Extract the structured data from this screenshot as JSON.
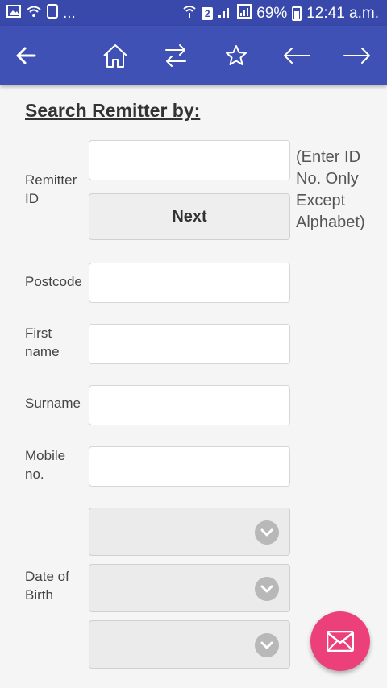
{
  "status_bar": {
    "overflow_dots": "...",
    "sim_number": "2",
    "battery": "69%",
    "time": "12:41 a.m."
  },
  "toolbar": {
    "icons": [
      "back-arrow-icon",
      "home-icon",
      "transfer-icon",
      "star-icon",
      "left-arrow-icon",
      "right-arrow-icon"
    ]
  },
  "form": {
    "heading": "Search Remitter by:",
    "remitter_id_label": "Remitter ID",
    "remitter_id_value": "",
    "next_label": "Next",
    "remitter_id_hint": "(Enter ID No. Only Except Alphabet)",
    "postcode_label": "Postcode",
    "postcode_value": "",
    "first_name_label": "First name",
    "first_name_value": "",
    "surname_label": "Surname",
    "surname_value": "",
    "mobile_label": "Mobile no.",
    "mobile_value": "",
    "dob_label": "Date of Birth",
    "dob_day": "",
    "dob_month": "",
    "dob_year": ""
  },
  "colors": {
    "status_bar": "#3949ab",
    "toolbar": "#3f51b5",
    "fab": "#ec407a",
    "background": "#f5f5f5"
  },
  "fab": {
    "icon": "mail-icon"
  }
}
